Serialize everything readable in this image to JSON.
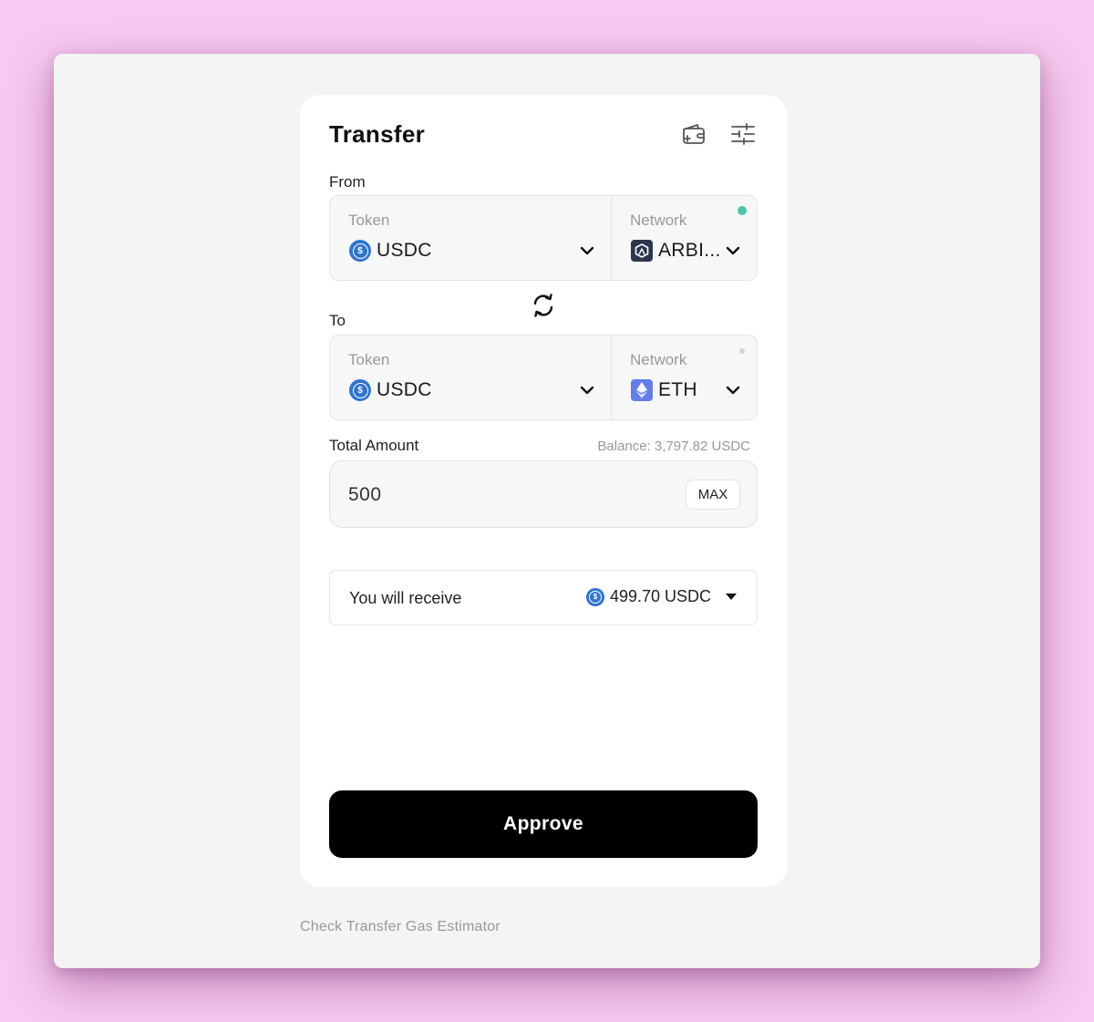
{
  "card": {
    "title": "Transfer",
    "header_icons": [
      "wallet-plus-icon",
      "sliders-icon"
    ]
  },
  "from": {
    "label": "From",
    "token_label": "Token",
    "token_value": "USDC",
    "token_icon": "usdc-coin-icon",
    "network_label": "Network",
    "network_value": "ARBI...",
    "network_icon": "arbitrum-logo-icon",
    "status_color": "#4cc4ac"
  },
  "swap_icon": "swap-arrows-icon",
  "to": {
    "label": "To",
    "token_label": "Token",
    "token_value": "USDC",
    "token_icon": "usdc-coin-icon",
    "network_label": "Network",
    "network_value": "ETH",
    "network_icon": "ethereum-logo-icon",
    "status_color": "#d4d4d4"
  },
  "amount": {
    "label": "Total Amount",
    "balance": "Balance: 3,797.82 USDC",
    "value": "500",
    "max_label": "MAX"
  },
  "receive": {
    "label": "You will receive",
    "value": "499.70 USDC"
  },
  "approve_label": "Approve",
  "footer_link": "Check Transfer Gas Estimator",
  "colors": {
    "background": "#f8c9f1",
    "window": "#f4f4f4",
    "card": "#ffffff",
    "primary_button": "#000000",
    "usdc_blue": "#2f75cf",
    "eth_purple": "#627eea",
    "arbitrum_dark": "#2d374b"
  }
}
